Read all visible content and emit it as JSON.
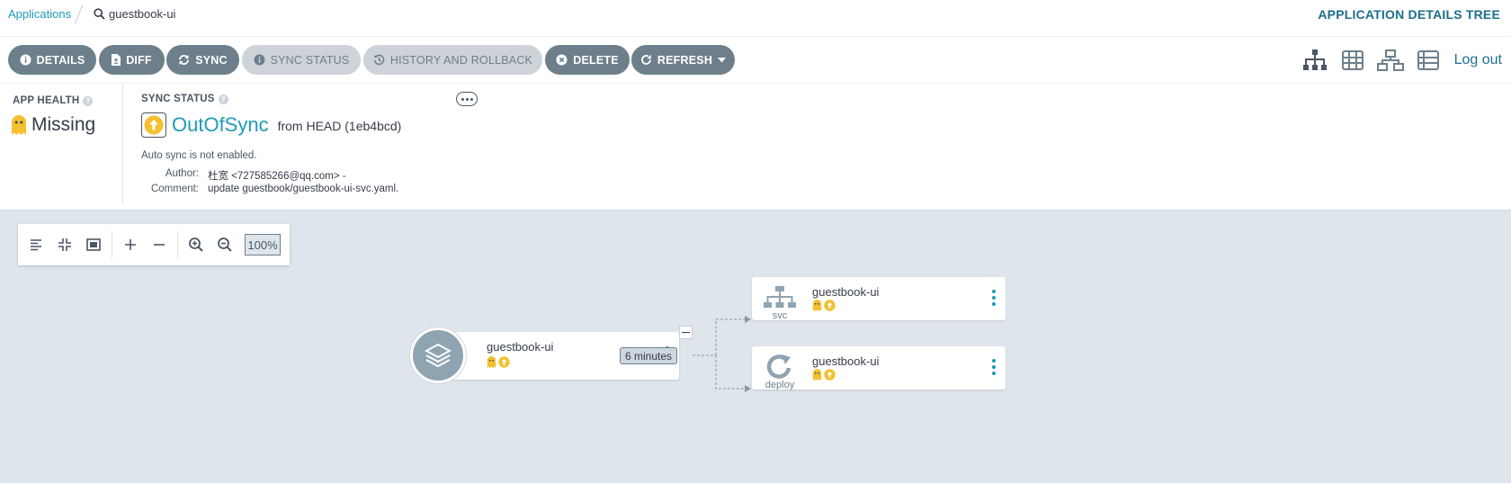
{
  "breadcrumb": {
    "applications_link": "Applications",
    "current_app": "guestbook-ui"
  },
  "page_title": "APPLICATION DETAILS TREE",
  "toolbar": {
    "details": "DETAILS",
    "diff": "DIFF",
    "sync": "SYNC",
    "sync_status": "SYNC STATUS",
    "history": "HISTORY AND ROLLBACK",
    "delete": "DELETE",
    "refresh": "REFRESH",
    "logout": "Log out",
    "view_icons": [
      "tree-view-icon",
      "pods-view-icon",
      "network-view-icon",
      "list-view-icon"
    ]
  },
  "status": {
    "app_health_label": "APP HEALTH",
    "app_health_value": "Missing",
    "sync_status_label": "SYNC STATUS",
    "sync_status_value": "OutOfSync",
    "sync_from": "from HEAD (1eb4bcd)",
    "auto_sync": "Auto sync is not enabled.",
    "author_label": "Author:",
    "author_value": "杜宽 <727585266@qq.com> -",
    "comment_label": "Comment:",
    "comment_value": "update guestbook/guestbook-ui-svc.yaml."
  },
  "zoom": {
    "value": "100%"
  },
  "tree": {
    "app_node": {
      "name": "guestbook-ui",
      "age": "6 minutes"
    },
    "children": [
      {
        "name": "guestbook-ui",
        "kind": "svc"
      },
      {
        "name": "guestbook-ui",
        "kind": "deploy"
      }
    ]
  },
  "colors": {
    "accent": "#1e9bb8",
    "missing_yellow": "#f4c030",
    "button_gray": "#6d7f8b",
    "canvas_bg": "#dee6eb"
  }
}
